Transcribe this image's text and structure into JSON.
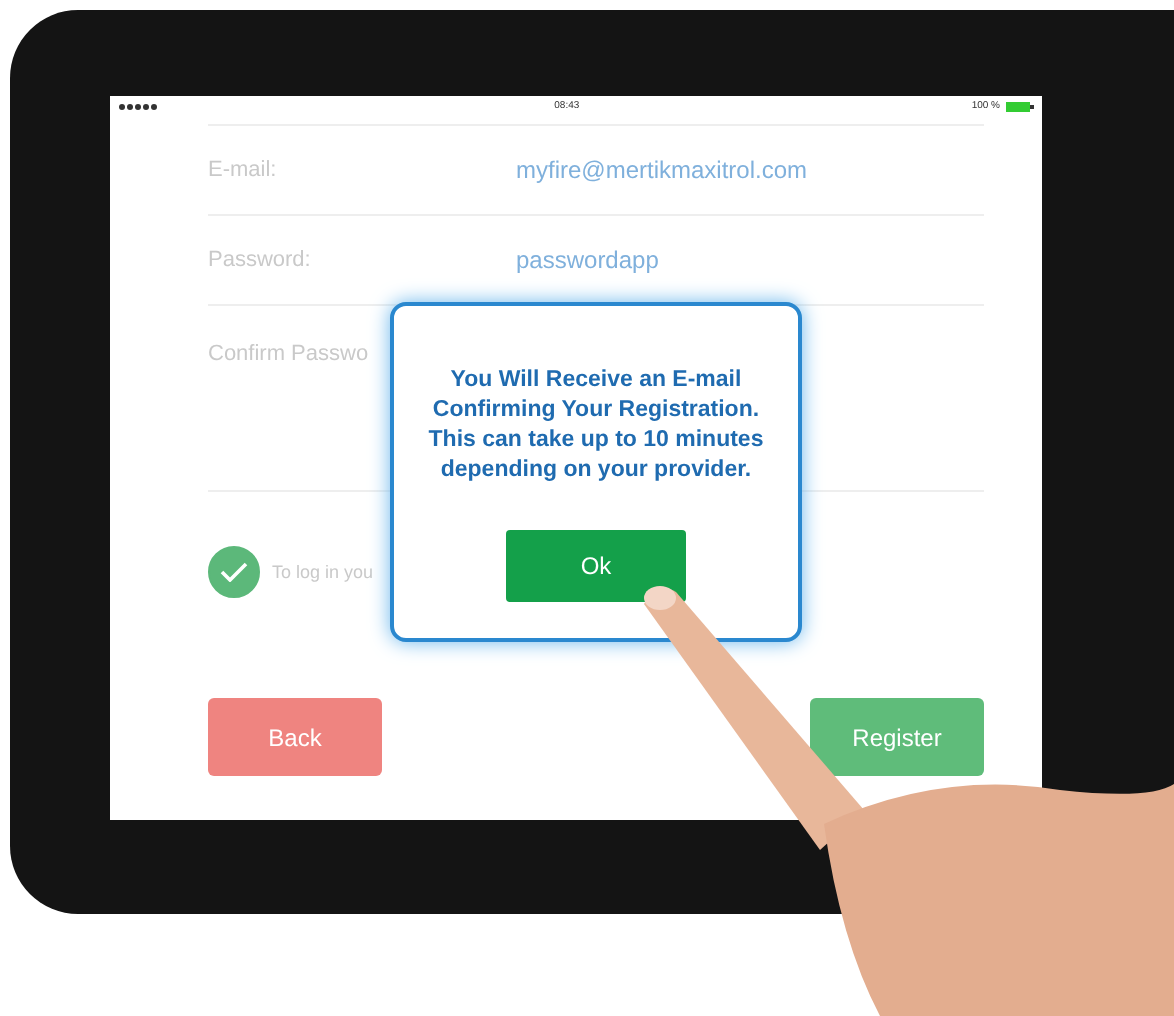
{
  "status_bar": {
    "time": "08:43",
    "battery": "100 %"
  },
  "form": {
    "fields": [
      {
        "label": "E-mail:",
        "value": "myfire@mertikmaxitrol.com"
      },
      {
        "label": "Password:",
        "value": "passwordapp"
      },
      {
        "label": "Confirm Passwo"
      }
    ],
    "consent": {
      "checked": true,
      "text": "To log in you"
    },
    "buttons": [
      {
        "label": "Back",
        "kind": "back"
      },
      {
        "label": "Register",
        "kind": "register"
      }
    ]
  },
  "dialog": {
    "message": "You Will Receive an E-mail Confirming Your Registration. This can take up to 10 minutes depending on your provider.",
    "button": "Ok"
  }
}
